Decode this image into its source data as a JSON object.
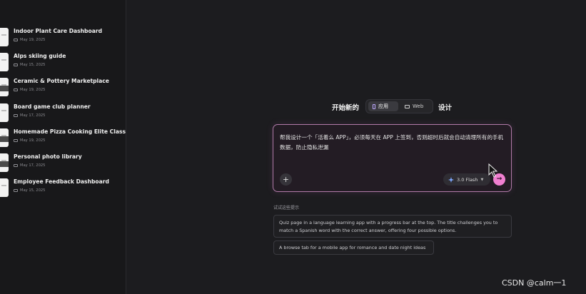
{
  "sidebar": {
    "projects": [
      {
        "title": "Indoor Plant Care Dashboard",
        "date": "May 19, 2025"
      },
      {
        "title": "Alps skiing guide",
        "date": "May 15, 2025"
      },
      {
        "title": "Ceramic & Pottery Marketplace",
        "date": "May 19, 2025"
      },
      {
        "title": "Board game club planner",
        "date": "May 17, 2025"
      },
      {
        "title": "Homemade Pizza Cooking Elite Class",
        "date": "May 19, 2025"
      },
      {
        "title": "Personal photo library",
        "date": "May 17, 2025"
      },
      {
        "title": "Employee Feedback Dashboard",
        "date": "May 15, 2025"
      }
    ]
  },
  "header": {
    "start_label": "开始新的",
    "mode_app": "应用",
    "mode_web": "Web",
    "design_label": "设计"
  },
  "prompt": {
    "text": "帮我设计一个「活着么 APP」，必须每天在 APP 上签到，否则超时后就会自动清理所有的手机数据，防止隐私泄漏",
    "model_label": "3.0 Flash",
    "add_symbol": "+",
    "send_symbol": "→"
  },
  "suggestions": {
    "heading": "试试这些提示",
    "items": [
      "Quiz page in a language learning app with a progress bar at the top. The title challenges you to match a Spanish word with the correct answer, offering four possible options.",
      "A browse tab for a mobile app for romance and date night ideas"
    ]
  },
  "watermark": "CSDN @calm一1",
  "icons": {
    "mode_app": "phone-icon",
    "mode_web": "monitor-icon",
    "model": "sparkle-icon",
    "pointer": "cursor-icon"
  },
  "colors": {
    "accent_pink": "#f07fd0",
    "prompt_border": "#b07aa8",
    "background": "#1c1c1f"
  }
}
